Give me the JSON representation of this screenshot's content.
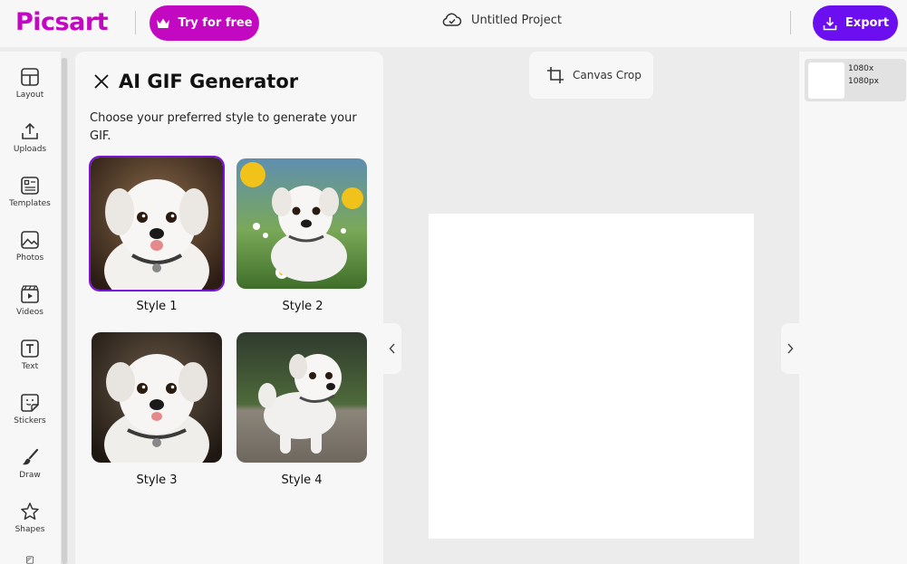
{
  "header": {
    "logo": "Picsart",
    "try_label": "Try for free",
    "project_name": "Untitled Project",
    "export_label": "Export"
  },
  "sidebar": {
    "items": [
      {
        "label": "Layout",
        "icon": "layout-icon"
      },
      {
        "label": "Uploads",
        "icon": "upload-icon"
      },
      {
        "label": "Templates",
        "icon": "templates-icon"
      },
      {
        "label": "Photos",
        "icon": "photos-icon"
      },
      {
        "label": "Videos",
        "icon": "videos-icon"
      },
      {
        "label": "Text",
        "icon": "text-icon"
      },
      {
        "label": "Stickers",
        "icon": "stickers-icon"
      },
      {
        "label": "Draw",
        "icon": "brush-icon"
      },
      {
        "label": "Shapes",
        "icon": "star-icon"
      }
    ]
  },
  "panel": {
    "title": "AI GIF Generator",
    "description": "Choose your preferred style to generate your GIF.",
    "styles": [
      {
        "label": "Style 1",
        "selected": true
      },
      {
        "label": "Style 2",
        "selected": false
      },
      {
        "label": "Style 3",
        "selected": false
      },
      {
        "label": "Style 4",
        "selected": false
      }
    ]
  },
  "toolbar": {
    "canvas_crop_label": "Canvas Crop"
  },
  "pages": {
    "size_line1": "1080x",
    "size_line2": "1080px"
  },
  "colors": {
    "brand": "#c209c1",
    "export": "#6b0ef0",
    "selected_outline": "#7b12dd"
  }
}
